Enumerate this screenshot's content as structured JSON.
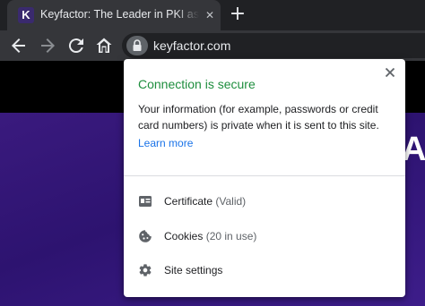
{
  "tab": {
    "favicon_letter": "K",
    "title": "Keyfactor: The Leader in PKI as-a-Service",
    "close_glyph": "✕",
    "new_tab_glyph": "+"
  },
  "toolbar": {
    "back_icon": "back-arrow-icon",
    "forward_icon": "forward-arrow-icon",
    "reload_icon": "reload-icon",
    "home_icon": "home-icon",
    "url": "keyfactor.com"
  },
  "page": {
    "hero_fragment": "Ac"
  },
  "popup": {
    "title": "Connection is secure",
    "description": "Your information (for example, passwords or credit card numbers) is private when it is sent to this site.",
    "learn_more": "Learn more",
    "items": [
      {
        "icon": "certificate-icon",
        "label": "Certificate",
        "detail": "(Valid)"
      },
      {
        "icon": "cookie-icon",
        "label": "Cookies",
        "detail": "(20 in use)"
      },
      {
        "icon": "gear-icon",
        "label": "Site settings",
        "detail": ""
      }
    ]
  },
  "colors": {
    "secure_green": "#1e8e3e",
    "link_blue": "#1a73e8",
    "page_purple": "#2d1370"
  }
}
